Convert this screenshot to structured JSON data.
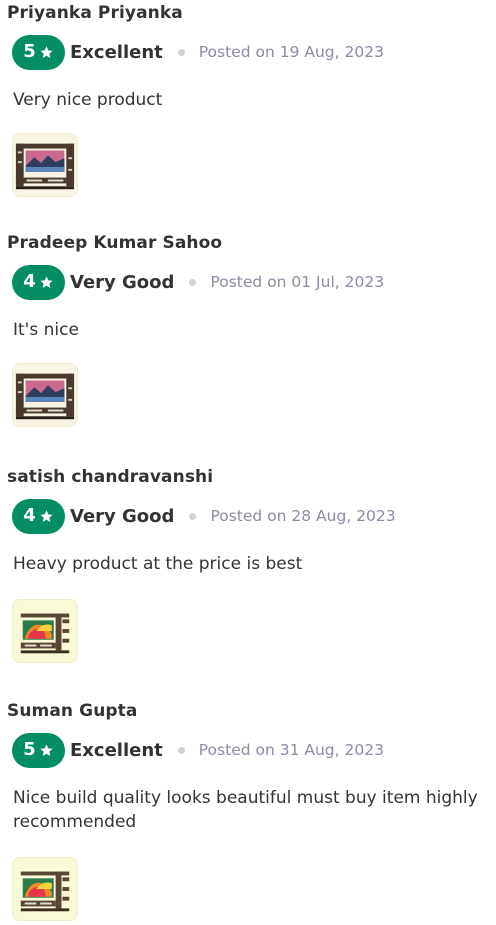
{
  "colors": {
    "rating_green": "#038D63",
    "text_primary": "#333333",
    "text_muted": "#8b8ba3",
    "separator_dot": "#d2d2d2"
  },
  "reviews": [
    {
      "name": "Priyanka Priyanka",
      "rating": "5",
      "rating_label": "Excellent",
      "posted": "Posted on 19 Aug, 2023",
      "text": "Very nice product",
      "image_icon": "tv-unit-photo-mountain"
    },
    {
      "name": "Pradeep Kumar Sahoo",
      "rating": "4",
      "rating_label": "Very Good",
      "posted": "Posted on 01 Jul, 2023",
      "text": "It's nice",
      "image_icon": "tv-unit-photo-mountain"
    },
    {
      "name": "satish chandravanshi",
      "rating": "4",
      "rating_label": "Very Good",
      "posted": "Posted on 28 Aug, 2023",
      "text": "Heavy product at the price is best",
      "image_icon": "tv-unit-photo-colorful"
    },
    {
      "name": "Suman Gupta",
      "rating": "5",
      "rating_label": "Excellent",
      "posted": "Posted on 31 Aug, 2023",
      "text": "Nice build quality looks beautiful must buy item highly recommended",
      "image_icon": "tv-unit-photo-colorful"
    }
  ]
}
